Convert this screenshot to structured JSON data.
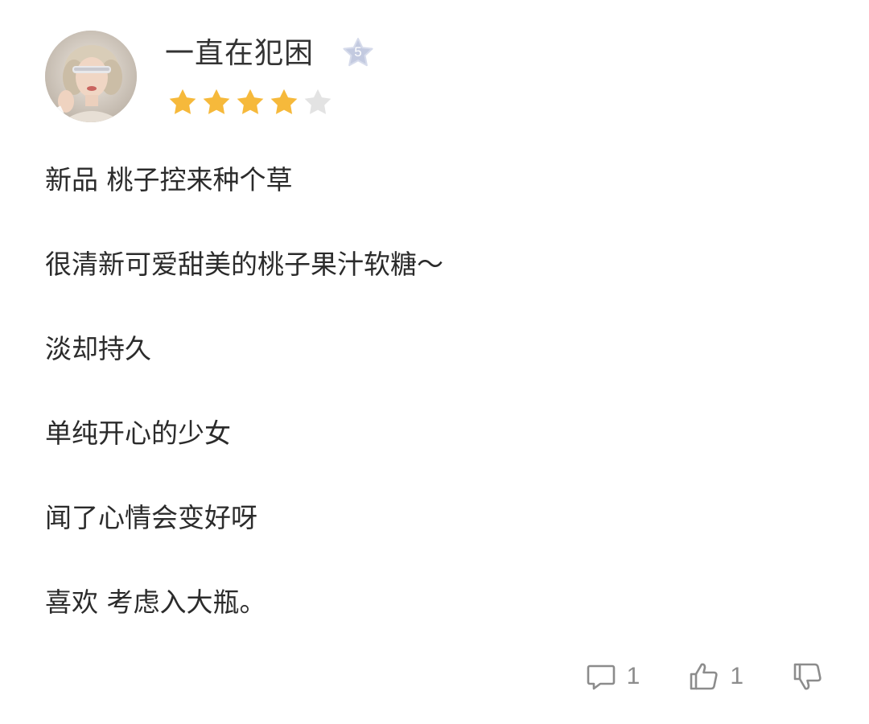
{
  "user": {
    "name": "一直在犯困",
    "level": "5",
    "avatar_icon": "avatar-photo"
  },
  "rating": {
    "value": 4,
    "max": 5,
    "filled_color": "#F6B93B",
    "empty_color": "#E3E3E3"
  },
  "review": {
    "lines": [
      "新品 桃子控来种个草",
      "很清新可爱甜美的桃子果汁软糖～",
      "淡却持久",
      "单纯开心的少女",
      "闻了心情会变好呀",
      "喜欢 考虑入大瓶。"
    ]
  },
  "actions": {
    "comment_count": "1",
    "like_count": "1",
    "icons": [
      "comment-icon",
      "thumbs-up-icon",
      "thumbs-down-icon"
    ]
  },
  "colors": {
    "badge": "#C3CAE0",
    "icon_gray": "#8C8C8C"
  }
}
